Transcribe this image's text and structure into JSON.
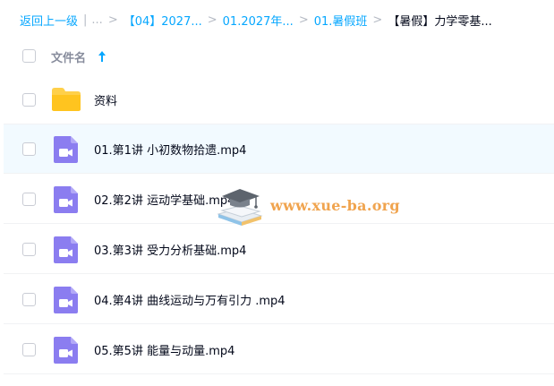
{
  "breadcrumb": {
    "back_label": "返回上一级",
    "ellipsis": "...",
    "items": [
      "【04】2027...",
      "01.2027年...",
      "01.暑假班"
    ],
    "current": "【暑假】力学零基..."
  },
  "list_header": {
    "filename_label": "文件名",
    "sort_icon": "arrow-up-icon",
    "sort_direction": "ascending"
  },
  "files": [
    {
      "name": "资料",
      "type": "folder",
      "icon": "folder-icon",
      "selected": false
    },
    {
      "name": "01.第1讲 小初数物拾遗.mp4",
      "type": "video",
      "icon": "video-file-icon",
      "selected": true
    },
    {
      "name": "02.第2讲 运动学基础.mp4",
      "type": "video",
      "icon": "video-file-icon",
      "selected": false
    },
    {
      "name": "03.第3讲 受力分析基础.mp4",
      "type": "video",
      "icon": "video-file-icon",
      "selected": false
    },
    {
      "name": "04.第4讲 曲线运动与万有引力 .mp4",
      "type": "video",
      "icon": "video-file-icon",
      "selected": false
    },
    {
      "name": "05.第5讲 能量与动量.mp4",
      "type": "video",
      "icon": "video-file-icon",
      "selected": false
    }
  ],
  "watermark": {
    "text": "www.xue-ba.org",
    "icon": "graduation-cap-books-icon"
  },
  "colors": {
    "accent": "#06a7ff",
    "video_icon": "#8b7df0",
    "folder": "#ffd04a",
    "selected_row": "#f2faff",
    "watermark": "#ef9b3c"
  }
}
